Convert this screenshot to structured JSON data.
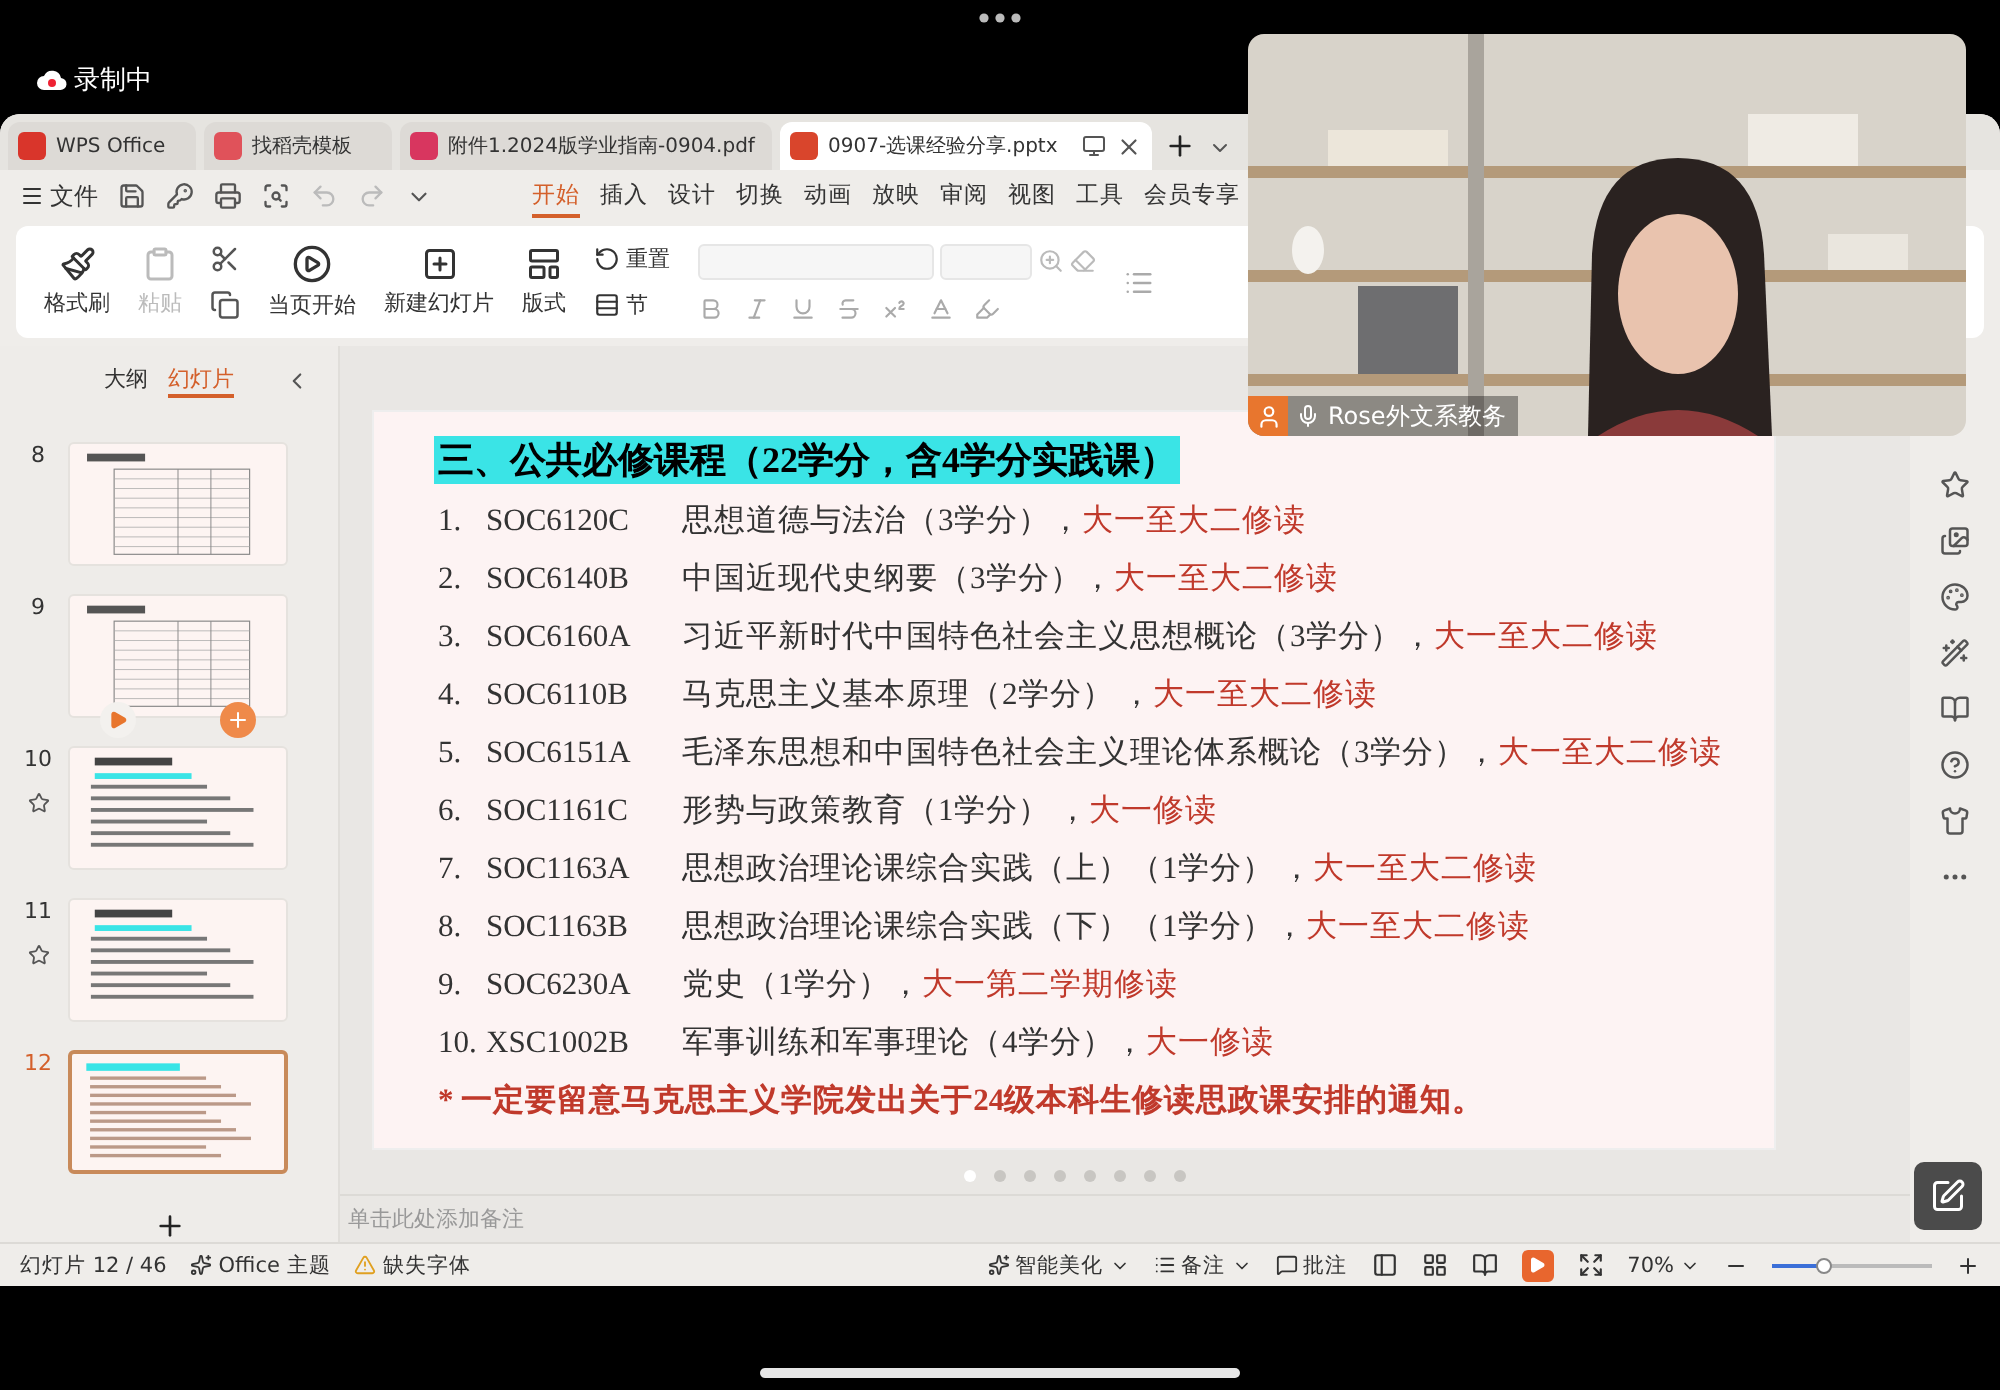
{
  "recording": {
    "label": "录制中"
  },
  "tabs": [
    {
      "label": "WPS Office",
      "kind": "home",
      "selected": false
    },
    {
      "label": "找稻壳模板",
      "kind": "template",
      "selected": false
    },
    {
      "label": "附件1.2024版学业指南-0904.pdf",
      "kind": "pdf",
      "selected": false
    },
    {
      "label": "0907-选课经验分享.pptx",
      "kind": "pptx",
      "selected": true
    }
  ],
  "file_menu": "文件",
  "ribbon_tabs": [
    {
      "label": "开始",
      "selected": true
    },
    {
      "label": "插入",
      "selected": false
    },
    {
      "label": "设计",
      "selected": false
    },
    {
      "label": "切换",
      "selected": false
    },
    {
      "label": "动画",
      "selected": false
    },
    {
      "label": "放映",
      "selected": false
    },
    {
      "label": "审阅",
      "selected": false
    },
    {
      "label": "视图",
      "selected": false
    },
    {
      "label": "工具",
      "selected": false
    },
    {
      "label": "会员专享",
      "selected": false
    }
  ],
  "ribbon": {
    "format_painter": "格式刷",
    "paste": {
      "label": "粘贴",
      "disabled": true
    },
    "play_current": "当页开始",
    "new_slide": "新建幻灯片",
    "layout": "版式",
    "reset": "重置",
    "section": "节"
  },
  "sidebar": {
    "tabs": [
      {
        "label": "大纲",
        "selected": false
      },
      {
        "label": "幻灯片",
        "selected": true
      }
    ],
    "slides": [
      {
        "number": "8",
        "kind": "table",
        "starred": false,
        "selected": false,
        "hovered": false
      },
      {
        "number": "9",
        "kind": "table",
        "starred": false,
        "selected": false,
        "hovered": true
      },
      {
        "number": "10",
        "kind": "text",
        "starred": true,
        "selected": false,
        "hovered": false
      },
      {
        "number": "11",
        "kind": "text",
        "starred": true,
        "selected": false,
        "hovered": false
      },
      {
        "number": "12",
        "kind": "list",
        "starred": false,
        "selected": true,
        "hovered": false
      }
    ]
  },
  "slide": {
    "title": "三、公共必修课程（22学分，含4学分实践课）",
    "items": [
      {
        "number": "1.",
        "code": "SOC6120C",
        "name": "思想道德与法治（3学分），",
        "note": "大一至大二修读"
      },
      {
        "number": "2.",
        "code": "SOC6140B",
        "name": "中国近现代史纲要（3学分），",
        "note": "大一至大二修读"
      },
      {
        "number": "3.",
        "code": "SOC6160A",
        "name": "习近平新时代中国特色社会主义思想概论（3学分），",
        "note": "大一至大二修读"
      },
      {
        "number": "4.",
        "code": "SOC6110B",
        "name": "马克思主义基本原理（2学分） ，",
        "note": "大一至大二修读"
      },
      {
        "number": "5.",
        "code": "SOC6151A",
        "name": "毛泽东思想和中国特色社会主义理论体系概论（3学分），",
        "note": "大一至大二修读"
      },
      {
        "number": "6.",
        "code": "SOC1161C",
        "name": "形势与政策教育（1学分） ，",
        "note": "大一修读"
      },
      {
        "number": "7.",
        "code": "SOC1163A",
        "name": "思想政治理论课综合实践（上）（1学分） ，",
        "note": "大一至大二修读"
      },
      {
        "number": "8.",
        "code": "SOC1163B",
        "name": "思想政治理论课综合实践（下）（1学分），",
        "note": "大一至大二修读"
      },
      {
        "number": "9.",
        "code": "SOC6230A",
        "name": "党史（1学分），",
        "note": "大一第二学期修读"
      },
      {
        "number": "10.",
        "code": "XSC1002B",
        "name": "军事训练和军事理论（4学分），",
        "note": "大一修读"
      }
    ],
    "footnote": "* 一定要留意马克思主义学院发出关于24级本科生修读思政课安排的通知。"
  },
  "page_dots": [
    {
      "selected": true
    },
    {
      "selected": false
    },
    {
      "selected": false
    },
    {
      "selected": false
    },
    {
      "selected": false
    },
    {
      "selected": false
    },
    {
      "selected": false
    },
    {
      "selected": false
    }
  ],
  "notes": {
    "placeholder": "单击此处添加备注"
  },
  "status_bar": {
    "slide_count": "幻灯片 12 / 46",
    "theme": "Office 主题",
    "missing_fonts": "缺失字体",
    "beautify": "智能美化",
    "notes": "备注",
    "comments": "批注",
    "zoom": "70%",
    "zoom_slider": {
      "level": 0.33
    }
  },
  "video": {
    "caption": "Rose外文系教务"
  }
}
